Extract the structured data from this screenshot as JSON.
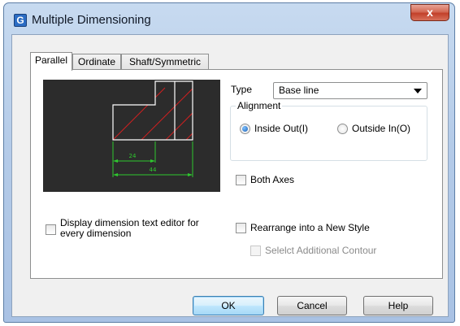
{
  "window": {
    "title": "Multiple Dimensioning",
    "close_symbol": "x"
  },
  "tabs": [
    {
      "label": "Parallel",
      "active": true
    },
    {
      "label": "Ordinate",
      "active": false
    },
    {
      "label": "Shaft/Symmetric",
      "active": false
    }
  ],
  "preview": {
    "dim_label_short": "24",
    "dim_label_long": "44",
    "colors": {
      "background": "#2c2c2c",
      "outline": "#ffffff",
      "hatch": "#d02020",
      "dimension": "#2ec82e"
    }
  },
  "type": {
    "label": "Type",
    "selected": "Base line"
  },
  "alignment": {
    "label": "Alignment",
    "options": [
      {
        "label": "Inside Out(I)",
        "checked": true
      },
      {
        "label": "Outside In(O)",
        "checked": false
      }
    ]
  },
  "both_axes": {
    "label": "Both Axes",
    "checked": false
  },
  "display_editor": {
    "label_line1": "Display dimension text editor for",
    "label_line2": "every dimension",
    "checked": false
  },
  "rearrange": {
    "label": "Rearrange into a New Style",
    "checked": false
  },
  "select_contour": {
    "label": "Selelct Additional Contour",
    "checked": false,
    "enabled": false
  },
  "buttons": {
    "ok": "OK",
    "cancel": "Cancel",
    "help": "Help"
  },
  "colors": {
    "accent": "#2b6cc4",
    "close": "#c2402a"
  }
}
